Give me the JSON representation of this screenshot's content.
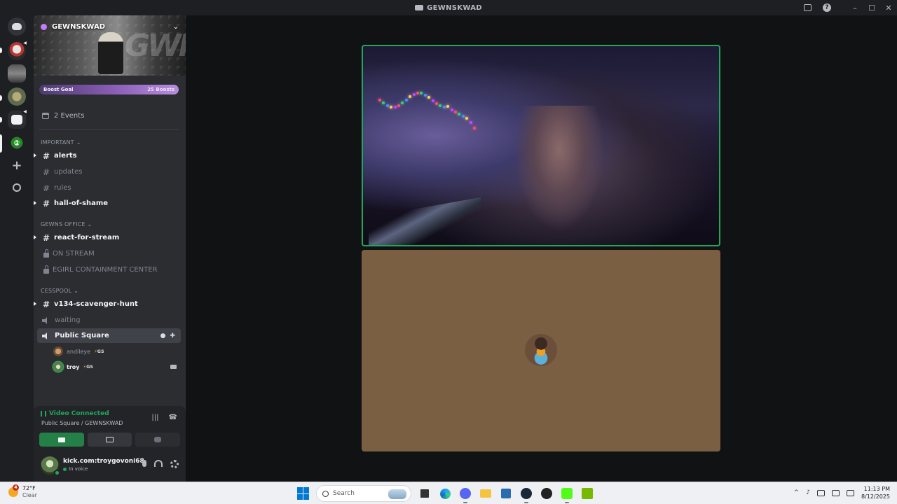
{
  "window": {
    "title": "GEWNSKWAD"
  },
  "server": {
    "name": "GEWNSKWAD",
    "boost_goal": "Boost Goal",
    "boost_count": "25 Boosts",
    "events": "2 Events"
  },
  "categories": {
    "important": "IMPORTANT",
    "office": "GEWNS OFFICE",
    "cesspool": "CESSPOOL"
  },
  "channels": {
    "alerts": "alerts",
    "updates": "updates",
    "rules": "rules",
    "hall": "hall-of-shame",
    "react": "react-for-stream",
    "onstream": "ON STREAM",
    "egirl": "EGIRL CONTAINMENT CENTER",
    "hunt": "v134-scavenger-hunt",
    "waiting": "waiting",
    "public": "Public Square"
  },
  "voice_users": [
    {
      "name": "andileye",
      "tag": "GS"
    },
    {
      "name": "troy",
      "tag": "GS"
    }
  ],
  "voice": {
    "status": "Video Connected",
    "channel": "Public Square / GEWNSKWAD"
  },
  "user": {
    "name": "kick.com:troygovoni68",
    "status": "In voice"
  },
  "taskbar": {
    "temp": "72°F",
    "condition": "Clear",
    "weather_badge": "4",
    "search_placeholder": "Search",
    "time": "11:13 PM",
    "date": "8/12/2025"
  },
  "colors": {
    "accent_green": "#23a55a",
    "blurple": "#5865f2",
    "tile_bg": "#7a5f42"
  }
}
